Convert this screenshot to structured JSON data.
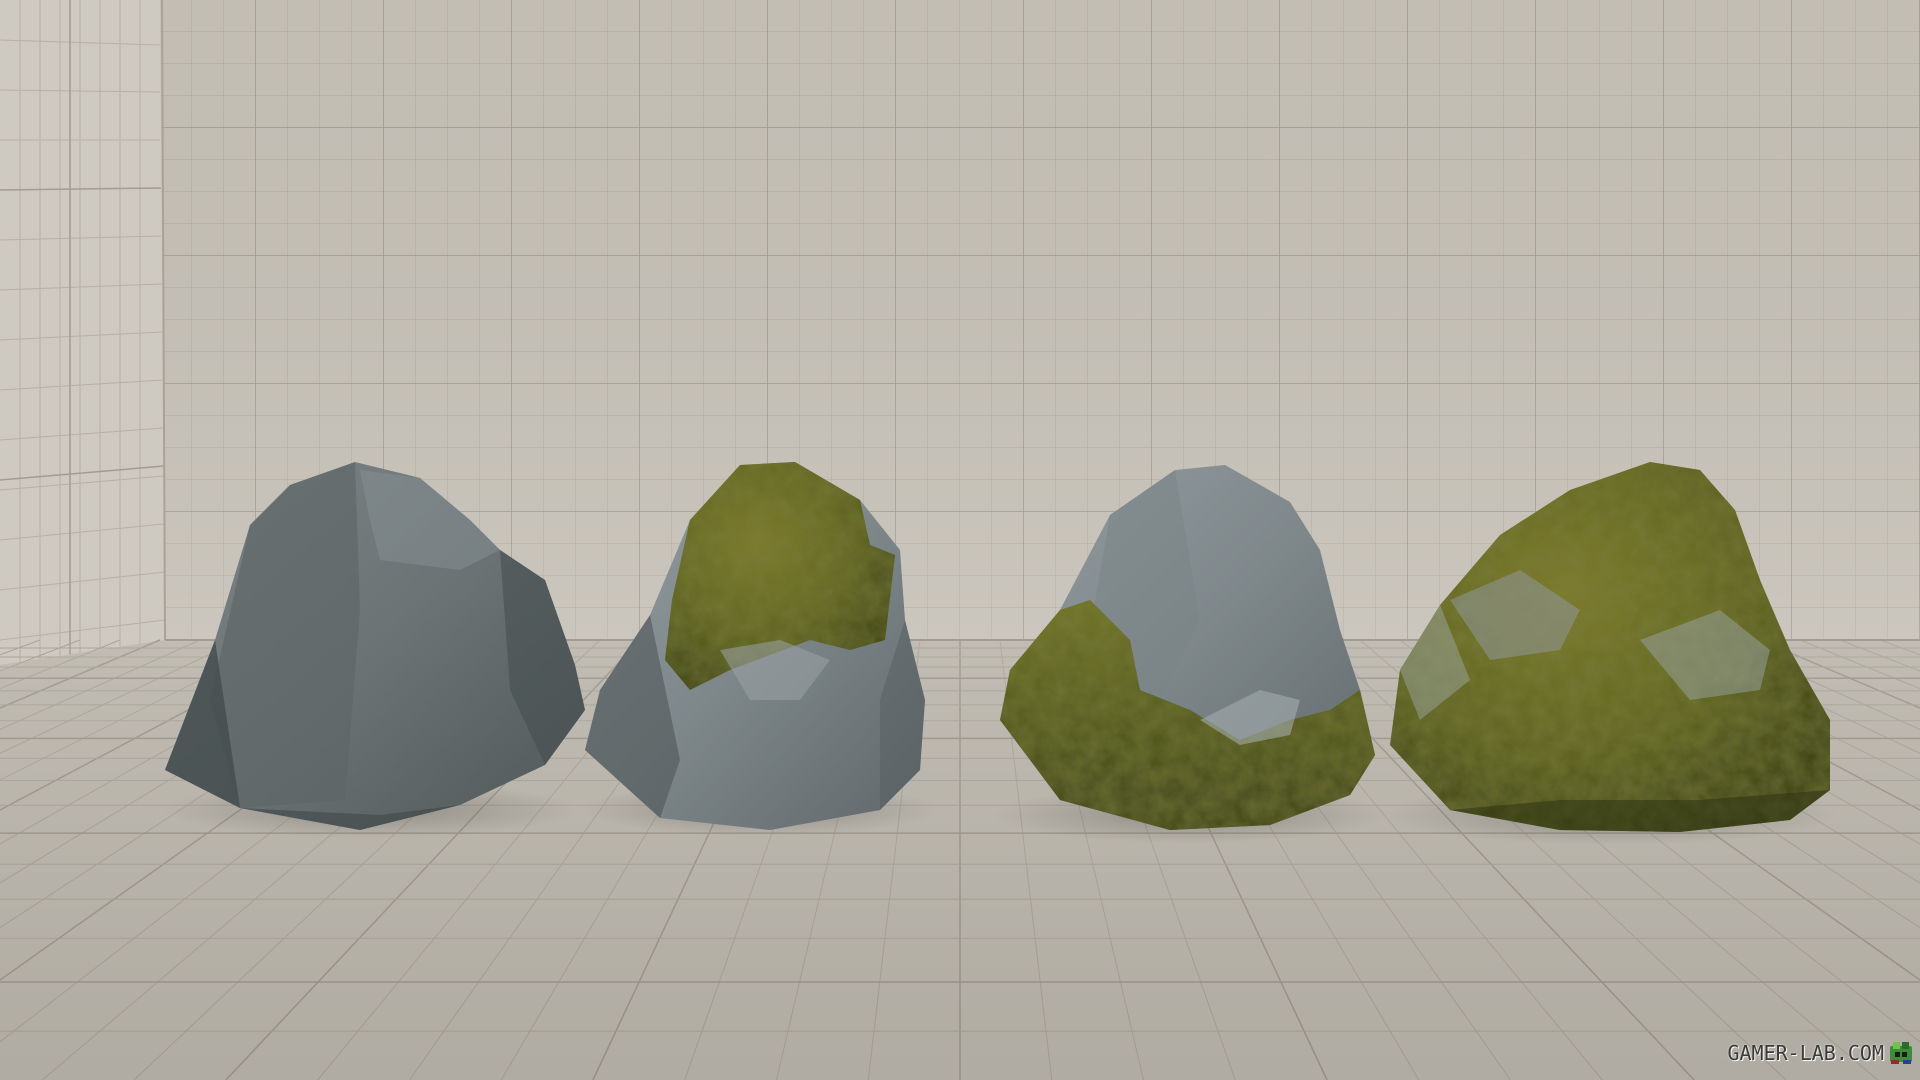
{
  "scene": {
    "description_visible_text": "",
    "colors": {
      "wall": "#c4bfb5",
      "wall_side": "#cbc6bd",
      "floor": "#bdb8ae",
      "grid_line": "#a9a398",
      "rock_grey": "#6f7678",
      "rock_grey_dark": "#4d5557",
      "moss": "#6b6d22",
      "moss_dark": "#3f4418"
    },
    "props": [
      {
        "name": "rock-plain",
        "variant": "plain"
      },
      {
        "name": "rock-moss-top",
        "variant": "moss-top"
      },
      {
        "name": "rock-moss-bottom",
        "variant": "moss-bottom"
      },
      {
        "name": "rock-moss-full",
        "variant": "moss-full"
      }
    ]
  },
  "watermark": {
    "text": "GAMER-LAB.COM",
    "logo_icon": "gamer-lab-logo-icon"
  }
}
